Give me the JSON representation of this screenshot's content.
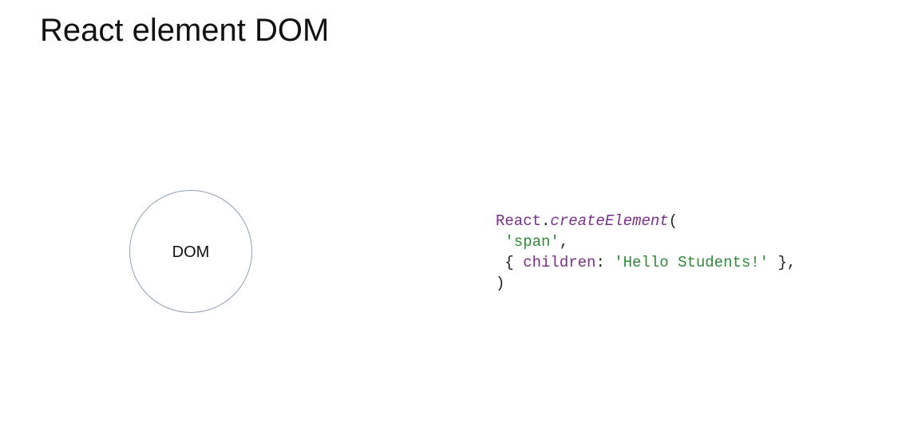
{
  "slide": {
    "title": "React element DOM"
  },
  "diagram": {
    "node_label": "DOM"
  },
  "code": {
    "line1": {
      "object": "React",
      "dot": ".",
      "method": "createElement",
      "paren_open": "("
    },
    "line2": {
      "indent": " ",
      "string": "'span'",
      "comma": ","
    },
    "line3": {
      "indent": " ",
      "brace_open": "{ ",
      "key": "children",
      "colon": ": ",
      "string": "'Hello Students!'",
      "brace_close": " },"
    },
    "line4": {
      "paren_close": ")"
    }
  },
  "colors": {
    "keyword_purple": "#7a2f8a",
    "string_green": "#2e8b3a",
    "circle_stroke": "#8fa0b6"
  }
}
